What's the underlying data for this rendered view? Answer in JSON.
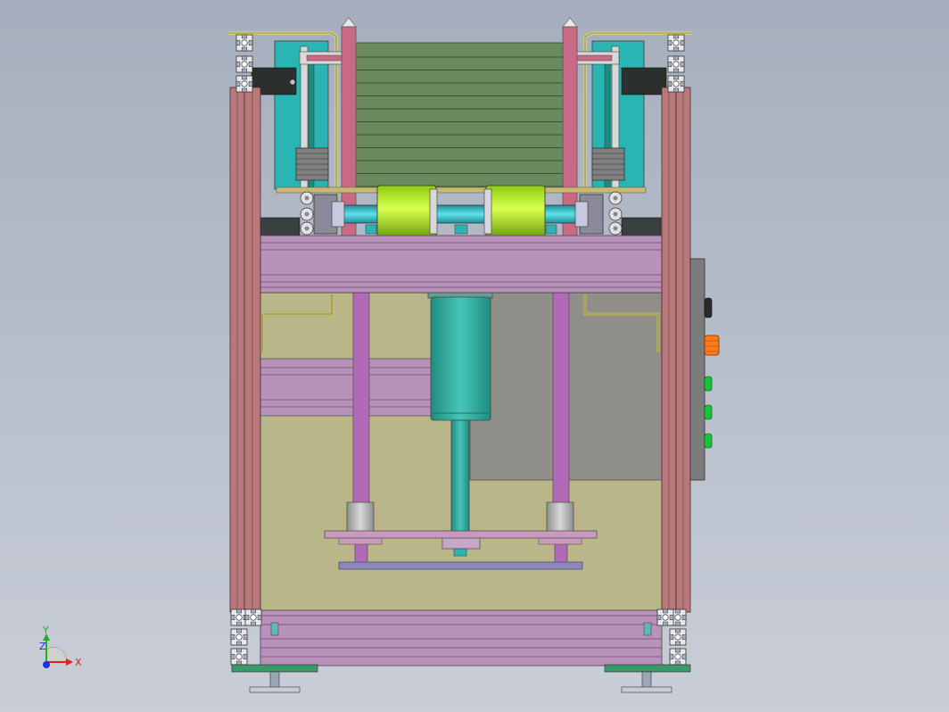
{
  "viewport": {
    "background_top": "#a6aebd",
    "background_bottom": "#c9ced8"
  },
  "colors": {
    "frame_profile": "#b7797c",
    "frame_dark": "#7b4c51",
    "crossbeam": "#b892b8",
    "crossbeam_dark": "#7e5a86",
    "panel_olive": "#b8b589",
    "panel_shadow": "#8f8e86",
    "cyan_block": "#2ab5b4",
    "motor_teal": "#3aa89a",
    "roller_lime": "#b8f02a",
    "stack_green": "#6b8a5e",
    "rod_pink": "#c86a86",
    "rod_violet": "#b26ab8",
    "control_panel": "#7c7c7c",
    "led_orange": "#ff7a1a",
    "led_green": "#18c43a",
    "foot_green": "#3a9a6a"
  },
  "triad": {
    "x_label": "X",
    "y_label": "Y",
    "z_label": "Z",
    "x_color": "#e02020",
    "y_color": "#20b020",
    "z_color": "#2030e0"
  }
}
